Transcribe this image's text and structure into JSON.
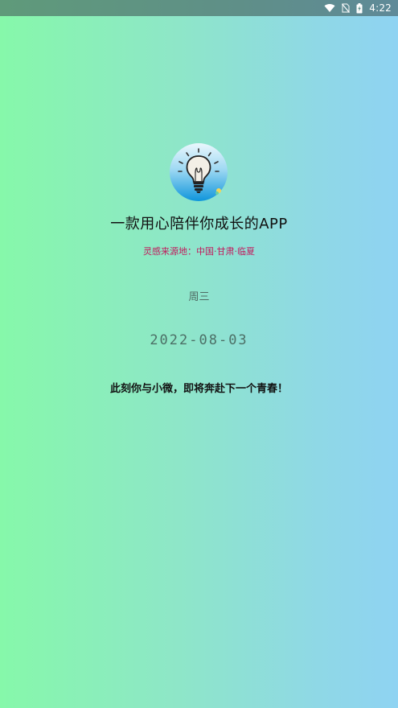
{
  "status_bar": {
    "time": "4:22",
    "icons": [
      "wifi-icon",
      "no-sim-icon",
      "battery-charging-icon"
    ]
  },
  "logo": {
    "icon": "lightbulb-icon"
  },
  "tagline": {
    "text": "一款用心陪伴你成长的APP"
  },
  "inspiration": {
    "text": "灵感来源地：中国·甘肃·临夏"
  },
  "weekday": {
    "text": "周三"
  },
  "date": {
    "text": "2022-08-03"
  },
  "motto": {
    "text": "此刻你与小微，即将奔赴下一个青春！"
  },
  "colors": {
    "gradient_left": "#86f8aa",
    "gradient_right": "#8fd3f2",
    "inspiration_text": "#c2185b",
    "logo_blue": "#1e9be0"
  }
}
